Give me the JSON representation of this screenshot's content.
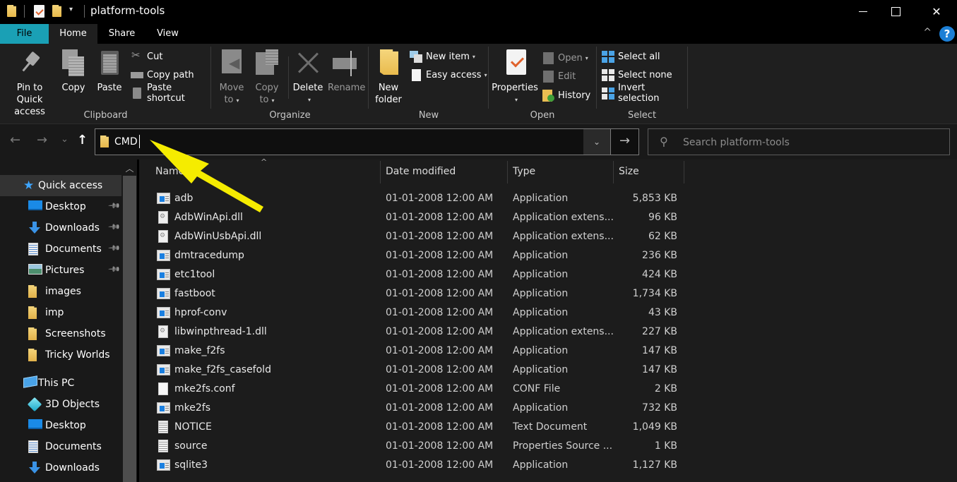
{
  "window": {
    "title": "platform-tools",
    "quick_access_toolbar": [
      "folder-icon",
      "properties-icon",
      "new-folder-icon",
      "customize-dropdown"
    ],
    "controls": {
      "minimize": "minimize",
      "maximize": "maximize",
      "close": "✕"
    }
  },
  "ribbon_tabs": [
    {
      "label": "File",
      "color": "#1aa0b5"
    },
    {
      "label": "Home",
      "active": true
    },
    {
      "label": "Share"
    },
    {
      "label": "View"
    }
  ],
  "ribbon": {
    "collapse_glyph": "^",
    "help_glyph": "?",
    "groups": {
      "clipboard": {
        "label": "Clipboard",
        "pin": [
          "Pin to Quick",
          "access"
        ],
        "copy": "Copy",
        "paste": "Paste",
        "cut": "Cut",
        "copy_path": "Copy path",
        "paste_shortcut": "Paste shortcut"
      },
      "organize": {
        "label": "Organize",
        "move_to": [
          "Move",
          "to"
        ],
        "copy_to": [
          "Copy",
          "to"
        ],
        "delete": "Delete",
        "rename": "Rename"
      },
      "new": {
        "label": "New",
        "new_folder": [
          "New",
          "folder"
        ],
        "new_item": "New item",
        "easy_access": "Easy access"
      },
      "open": {
        "label": "Open",
        "properties": "Properties",
        "open": "Open",
        "edit": "Edit",
        "history": "History"
      },
      "select": {
        "label": "Select",
        "select_all": "Select all",
        "select_none": "Select none",
        "invert_selection": "Invert selection"
      }
    }
  },
  "nav": {
    "back": "←",
    "forward": "→",
    "recent": "⌄",
    "up": "↑",
    "address_value": "CMD",
    "address_dropdown": "⌄",
    "go": "→",
    "search_placeholder": "Search platform-tools"
  },
  "sidebar": {
    "items": [
      {
        "label": "Quick access",
        "icon": "star-icon",
        "level": 0,
        "active": true
      },
      {
        "label": "Desktop",
        "icon": "desktop-icon",
        "level": 1,
        "pinned": true
      },
      {
        "label": "Downloads",
        "icon": "downloads-icon",
        "level": 1,
        "pinned": true
      },
      {
        "label": "Documents",
        "icon": "documents-icon",
        "level": 1,
        "pinned": true
      },
      {
        "label": "Pictures",
        "icon": "pictures-icon",
        "level": 1,
        "pinned": true
      },
      {
        "label": "images",
        "icon": "folder-icon",
        "level": 1
      },
      {
        "label": "imp",
        "icon": "folder-icon",
        "level": 1
      },
      {
        "label": "Screenshots",
        "icon": "folder-icon",
        "level": 1
      },
      {
        "label": "Tricky Worlds",
        "icon": "folder-icon",
        "level": 1
      },
      {
        "label": "This PC",
        "icon": "this-pc-icon",
        "level": 0
      },
      {
        "label": "3D Objects",
        "icon": "3d-objects-icon",
        "level": 1
      },
      {
        "label": "Desktop",
        "icon": "desktop-icon",
        "level": 1
      },
      {
        "label": "Documents",
        "icon": "documents-icon",
        "level": 1
      },
      {
        "label": "Downloads",
        "icon": "downloads-icon",
        "level": 1
      }
    ]
  },
  "file_list": {
    "columns": [
      "Name",
      "Date modified",
      "Type",
      "Size"
    ],
    "sort_indicator": "^",
    "rows": [
      {
        "name": "adb",
        "icon": "app",
        "date": "01-01-2008 12:00 AM",
        "type": "Application",
        "size": "5,853 KB"
      },
      {
        "name": "AdbWinApi.dll",
        "icon": "dll",
        "date": "01-01-2008 12:00 AM",
        "type": "Application extens...",
        "size": "96 KB"
      },
      {
        "name": "AdbWinUsbApi.dll",
        "icon": "dll",
        "date": "01-01-2008 12:00 AM",
        "type": "Application extens...",
        "size": "62 KB"
      },
      {
        "name": "dmtracedump",
        "icon": "app",
        "date": "01-01-2008 12:00 AM",
        "type": "Application",
        "size": "236 KB"
      },
      {
        "name": "etc1tool",
        "icon": "app",
        "date": "01-01-2008 12:00 AM",
        "type": "Application",
        "size": "424 KB"
      },
      {
        "name": "fastboot",
        "icon": "app",
        "date": "01-01-2008 12:00 AM",
        "type": "Application",
        "size": "1,734 KB"
      },
      {
        "name": "hprof-conv",
        "icon": "app",
        "date": "01-01-2008 12:00 AM",
        "type": "Application",
        "size": "43 KB"
      },
      {
        "name": "libwinpthread-1.dll",
        "icon": "dll",
        "date": "01-01-2008 12:00 AM",
        "type": "Application extens...",
        "size": "227 KB"
      },
      {
        "name": "make_f2fs",
        "icon": "app",
        "date": "01-01-2008 12:00 AM",
        "type": "Application",
        "size": "147 KB"
      },
      {
        "name": "make_f2fs_casefold",
        "icon": "app",
        "date": "01-01-2008 12:00 AM",
        "type": "Application",
        "size": "147 KB"
      },
      {
        "name": "mke2fs.conf",
        "icon": "blank",
        "date": "01-01-2008 12:00 AM",
        "type": "CONF File",
        "size": "2 KB"
      },
      {
        "name": "mke2fs",
        "icon": "app",
        "date": "01-01-2008 12:00 AM",
        "type": "Application",
        "size": "732 KB"
      },
      {
        "name": "NOTICE",
        "icon": "text",
        "date": "01-01-2008 12:00 AM",
        "type": "Text Document",
        "size": "1,049 KB"
      },
      {
        "name": "source",
        "icon": "text",
        "date": "01-01-2008 12:00 AM",
        "type": "Properties Source ...",
        "size": "1 KB"
      },
      {
        "name": "sqlite3",
        "icon": "app",
        "date": "01-01-2008 12:00 AM",
        "type": "Application",
        "size": "1,127 KB"
      }
    ]
  },
  "annotation": {
    "type": "arrow",
    "color": "#f5ec00",
    "points_to": "address-bar"
  }
}
